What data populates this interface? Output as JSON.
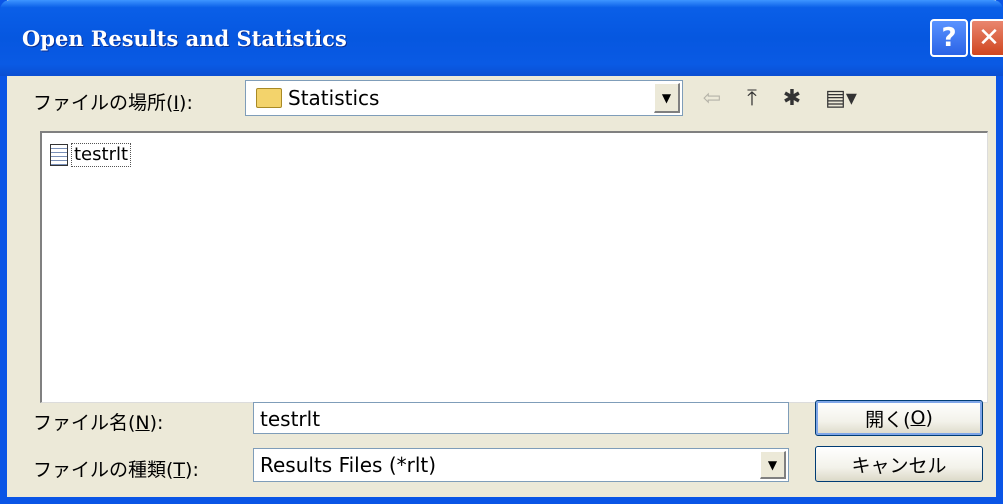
{
  "window": {
    "title": "Open Results and Statistics",
    "help": "?",
    "close": "✕"
  },
  "location": {
    "label_pre": "ファイルの場所(",
    "label_key": "I",
    "label_post": "):",
    "value": "Statistics"
  },
  "toolbar": {
    "back": "⇦",
    "up": "⤒",
    "new_folder": "✱",
    "view": "▤▾"
  },
  "files": [
    {
      "name": "testrlt"
    }
  ],
  "filename": {
    "label_pre": "ファイル名(",
    "label_key": "N",
    "label_post": "):",
    "value": "testrlt"
  },
  "filetype": {
    "label_pre": "ファイルの種類(",
    "label_key": "T",
    "label_post": "):",
    "value": "Results Files (*rlt)"
  },
  "buttons": {
    "open_pre": "開く(",
    "open_key": "O",
    "open_post": ")",
    "cancel": "キャンセル"
  },
  "colors": {
    "title_bar": "#0657e0",
    "face": "#ece9d8",
    "close": "#d0461f"
  }
}
